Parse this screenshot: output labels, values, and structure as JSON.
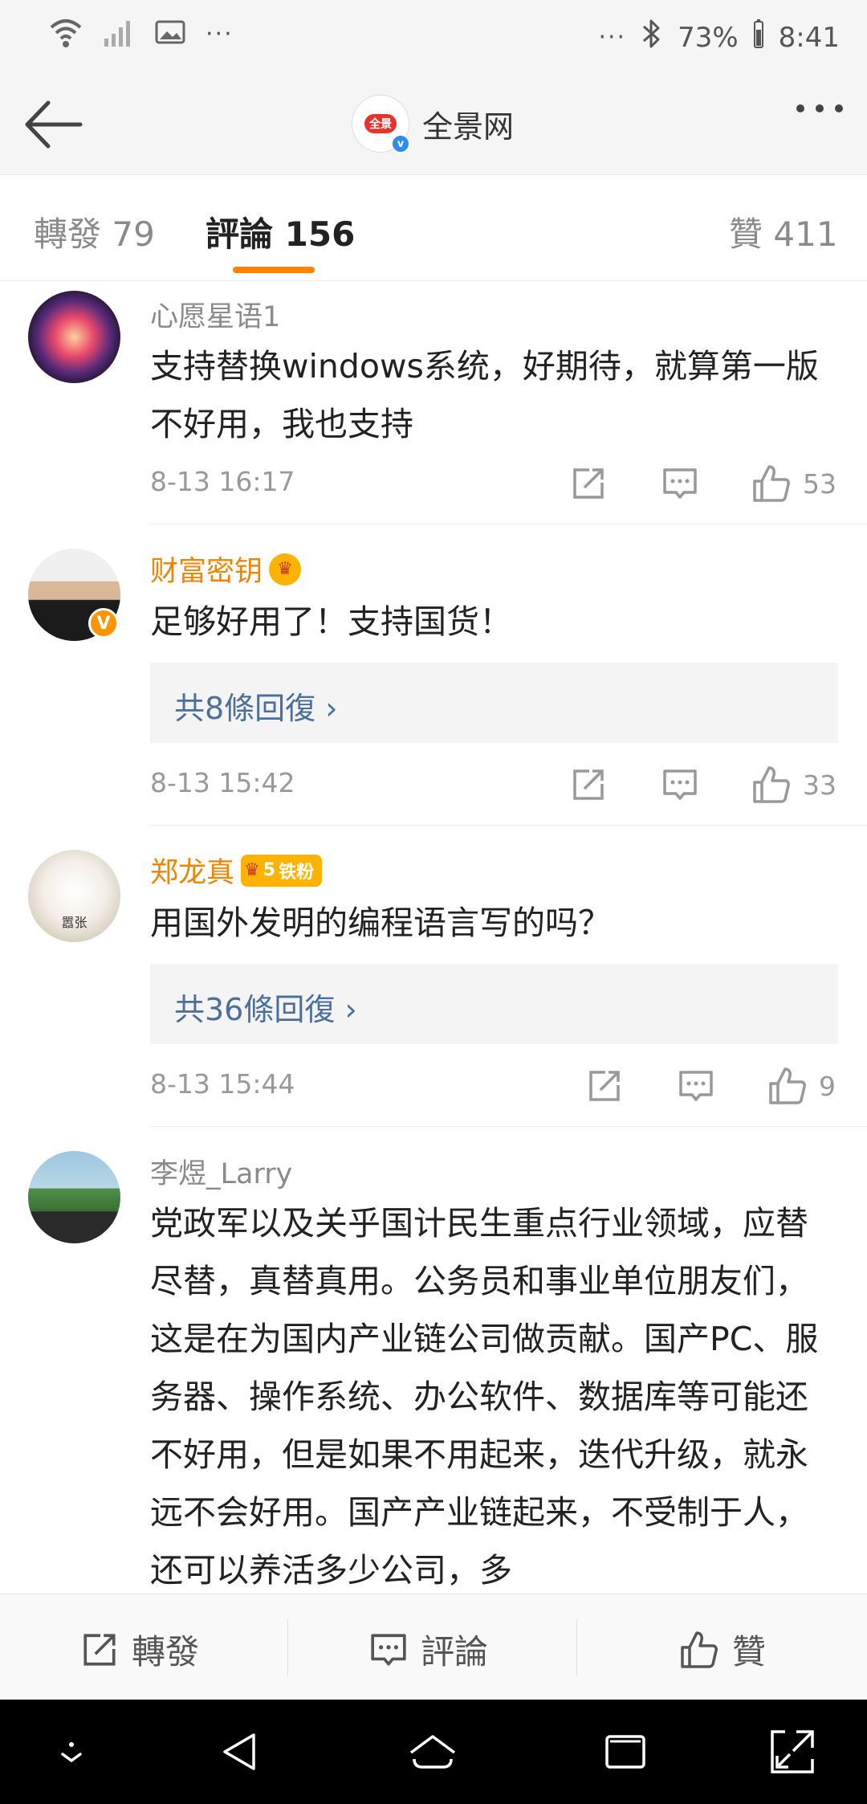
{
  "status_bar": {
    "battery": "73%",
    "time": "8:41",
    "overflow": "···"
  },
  "header": {
    "account_name": "全景网",
    "logo_text": "全景"
  },
  "tabs": {
    "reposts_label": "轉發",
    "reposts_count": "79",
    "comments_label": "評論",
    "comments_count": "156",
    "likes_label": "贊",
    "likes_count": "411",
    "accent": "#ff8200"
  },
  "comments": [
    {
      "user": "心愿星语1",
      "text": "支持替换windows系统，好期待，就算第一版不好用，我也支持",
      "time": "8-13 16:17",
      "likes": "53"
    },
    {
      "user": "财富密钥",
      "text": "足够好用了！支持国货！",
      "replies": "共8條回復",
      "time": "8-13 15:42",
      "likes": "33"
    },
    {
      "user": "郑龙真",
      "badge_level": "5",
      "badge_text": "铁粉",
      "avatar_caption": "嚣张",
      "text": "用国外发明的编程语言写的吗？",
      "replies": "共36條回復",
      "time": "8-13 15:44",
      "likes": "9"
    },
    {
      "user": "李煜_Larry",
      "text": "党政军以及关乎国计民生重点行业领域，应替尽替，真替真用。公务员和事业单位朋友们，这是在为国内产业链公司做贡献。国产PC、服务器、操作系统、办公软件、数据库等可能还不好用，但是如果不用起来，迭代升级，就永远不会好用。国产产业链起来，不受制于人，还可以养活多少公司，多"
    }
  ],
  "action_bar": {
    "repost": "轉發",
    "comment": "評論",
    "like": "贊"
  },
  "icons": {
    "back": "arrow-left-icon",
    "more": "more-dots-icon",
    "share": "share-icon",
    "comment": "comment-icon",
    "like": "thumbs-up-icon"
  }
}
